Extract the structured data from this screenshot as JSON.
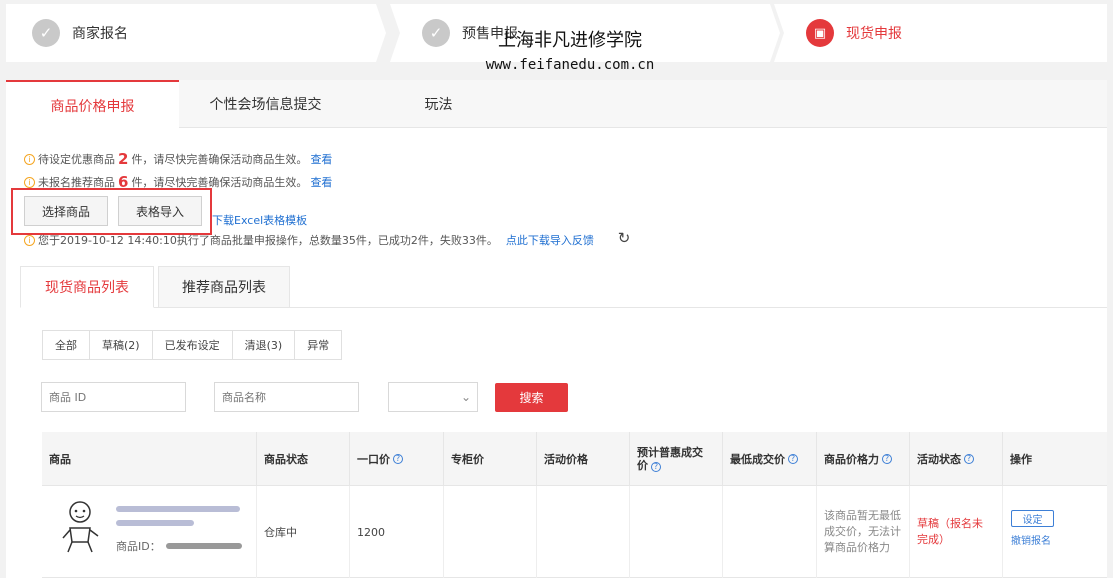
{
  "steps": [
    {
      "label": "商家报名",
      "icon": "✓"
    },
    {
      "label": "预售申报",
      "icon": "✓"
    },
    {
      "label": "现货申报",
      "icon": "▣"
    }
  ],
  "watermark": {
    "line1": "上海非凡进修学院",
    "line2": "www.feifanedu.com.cn"
  },
  "main_tabs": [
    "商品价格申报",
    "个性会场信息提交",
    "玩法"
  ],
  "notices": [
    {
      "prefix": "待设定优惠商品",
      "count": "2",
      "suffix": "件，请尽快完善确保活动商品生效。",
      "link": "查看"
    },
    {
      "prefix": "未报名推荐商品",
      "count": "6",
      "suffix": "件，请尽快完善确保活动商品生效。",
      "link": "查看"
    }
  ],
  "buttons": {
    "select": "选择商品",
    "import": "表格导入"
  },
  "template_link": "下载Excel表格模板",
  "import_log": {
    "text": "您于2019-10-12 14:40:10执行了商品批量申报操作，总数量35件，已成功2件，失败33件。",
    "link": "点此下载导入反馈"
  },
  "sub_tabs": [
    "现货商品列表",
    "推荐商品列表"
  ],
  "filters": [
    "全部",
    "草稿(2)",
    "已发布设定",
    "清退(3)",
    "异常"
  ],
  "search": {
    "id_placeholder": "商品 ID",
    "name_placeholder": "商品名称",
    "button": "搜索"
  },
  "table": {
    "headers": {
      "product": "商品",
      "status": "商品状态",
      "price": "一口价",
      "counter": "专柜价",
      "activity": "活动价格",
      "estimate": "预计普惠成交价",
      "lowest": "最低成交价",
      "power": "商品价格力",
      "act_status": "活动状态",
      "op": "操作"
    },
    "row": {
      "id_label": "商品ID：",
      "status": "仓库中",
      "price": "1200",
      "note": "该商品暂无最低成交价，无法计算商品价格力",
      "act_status": "草稿（报名未完成）",
      "op_set": "设定",
      "op_cancel": "撤销报名"
    }
  },
  "colors": {
    "accent": "#e4393c",
    "link": "#1f6fd1",
    "warning": "#f5a623"
  }
}
